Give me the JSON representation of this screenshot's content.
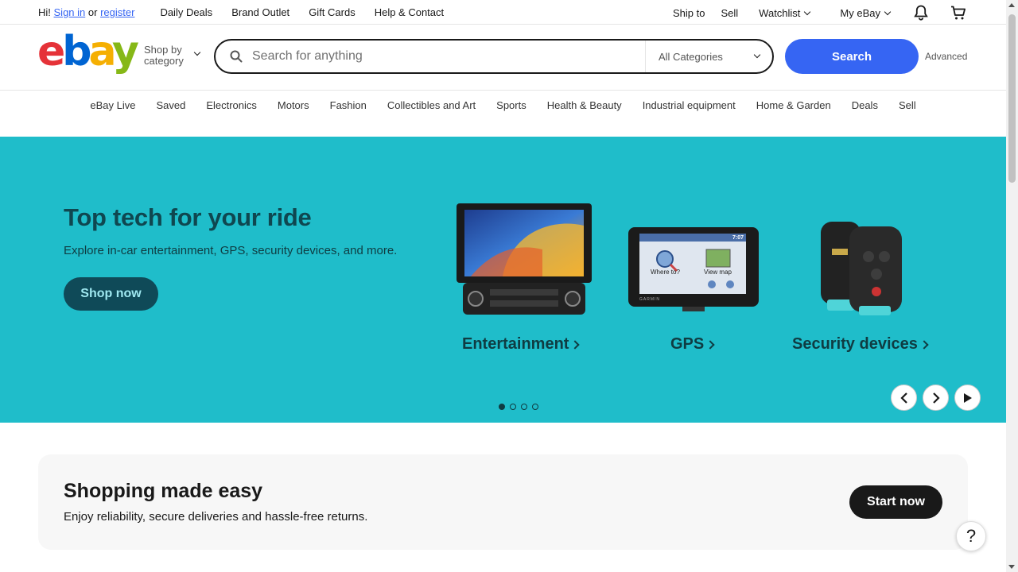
{
  "topbar": {
    "greeting": "Hi!",
    "sign_in": "Sign in",
    "or": "or",
    "register": "register",
    "links": [
      "Daily Deals",
      "Brand Outlet",
      "Gift Cards",
      "Help & Contact"
    ],
    "ship_to": "Ship to",
    "sell": "Sell",
    "watchlist": "Watchlist",
    "my_ebay": "My eBay",
    "icons": {
      "notifications": "bell-icon",
      "cart": "cart-icon"
    }
  },
  "header": {
    "logo": {
      "e": "e",
      "b": "b",
      "a": "a",
      "y": "y"
    },
    "shop_by_line1": "Shop by",
    "shop_by_line2": "category",
    "search_placeholder": "Search for anything",
    "category_select": "All Categories",
    "search_button": "Search",
    "advanced": "Advanced"
  },
  "catnav": [
    "eBay Live",
    "Saved",
    "Electronics",
    "Motors",
    "Fashion",
    "Collectibles and Art",
    "Sports",
    "Health & Beauty",
    "Industrial equipment",
    "Home & Garden",
    "Deals",
    "Sell"
  ],
  "hero": {
    "title": "Top tech for your ride",
    "subtitle": "Explore in-car entertainment, GPS, security devices, and more.",
    "cta": "Shop now",
    "tiles": [
      {
        "label": "Entertainment"
      },
      {
        "label": "GPS"
      },
      {
        "label": "Security devices"
      }
    ],
    "gps_screen": {
      "where_to": "Where to?",
      "view_map": "View map",
      "time": "7:07",
      "brand": "GARMIN"
    },
    "slide_count": 4,
    "active_slide": 1,
    "colors": {
      "background": "#1fbdca",
      "title": "#0f4750"
    }
  },
  "easy": {
    "title": "Shopping made easy",
    "subtitle": "Enjoy reliability, secure deliveries and hassle-free returns.",
    "cta": "Start now"
  },
  "help": "?"
}
